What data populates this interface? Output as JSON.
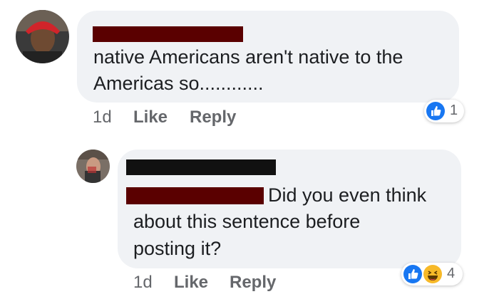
{
  "comment": {
    "text_line1": "native Americans aren't native to the",
    "text_line2": "Americas so............",
    "time": "1d",
    "like_label": "Like",
    "reply_label": "Reply",
    "reaction_count": "1",
    "reactions": [
      "like-icon"
    ]
  },
  "reply": {
    "text_line1": "Did you even think",
    "text_line2": "about this sentence before",
    "text_line3": "posting it?",
    "time": "1d",
    "like_label": "Like",
    "reply_label": "Reply",
    "reaction_count": "4",
    "reactions": [
      "like-icon",
      "haha-icon"
    ]
  },
  "colors": {
    "bubble": "#f0f2f5",
    "redaction_dark_red": "#5a0000",
    "redaction_black": "#111111",
    "like_blue": "#1877f2",
    "haha_yellow": "#f7b928",
    "meta_gray": "#65676b"
  }
}
